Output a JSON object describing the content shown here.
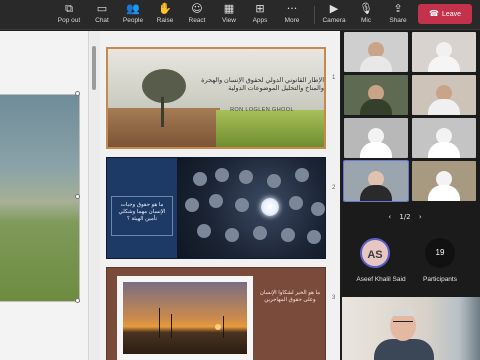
{
  "toolbar": {
    "items": [
      {
        "label": "Pop out",
        "icon": "pop-out-icon",
        "glyph": "⧉"
      },
      {
        "label": "Chat",
        "icon": "chat-icon",
        "glyph": "▭"
      },
      {
        "label": "People",
        "icon": "people-icon",
        "glyph": "👥"
      },
      {
        "label": "Raise",
        "icon": "raise-hand-icon",
        "glyph": "✋"
      },
      {
        "label": "React",
        "icon": "react-icon",
        "glyph": "☺"
      },
      {
        "label": "View",
        "icon": "view-icon",
        "glyph": "▦"
      },
      {
        "label": "Apps",
        "icon": "apps-icon",
        "glyph": "⊞"
      },
      {
        "label": "More",
        "icon": "more-icon",
        "glyph": "···"
      },
      {
        "label": "Camera",
        "icon": "camera-icon",
        "glyph": "▶"
      },
      {
        "label": "Mic",
        "icon": "mic-icon",
        "glyph": "🎙"
      },
      {
        "label": "Share",
        "icon": "share-icon",
        "glyph": "⇪"
      }
    ],
    "leave": {
      "label": "Leave",
      "icon": "phone-icon",
      "glyph": "☎",
      "color": "#c4314b"
    }
  },
  "slides": {
    "items": [
      {
        "number": "1",
        "title": "الإطار القانوني الدولي لحقوق الإنسان والهجرة والمناخ والتحليل الموضوعات الدولية",
        "author": "RON LOGLEN GHOOL"
      },
      {
        "number": "2",
        "text": "ما هو حقوق وجبات الإنسان مهما وشكلي تأمين الهيئة ؟"
      },
      {
        "number": "3",
        "text": "ما هو الخير لشكاوا الإنسان وعلى حقوق المهاجرين"
      }
    ]
  },
  "gallery": {
    "pager": {
      "label": "1/2",
      "prev_glyph": "‹",
      "next_glyph": "›"
    },
    "participant": {
      "initials": "AS",
      "name": "Aseef Khalil Said",
      "accent": "#5b5fc7"
    },
    "participants_count": {
      "count": "19",
      "label": "Participants"
    }
  }
}
